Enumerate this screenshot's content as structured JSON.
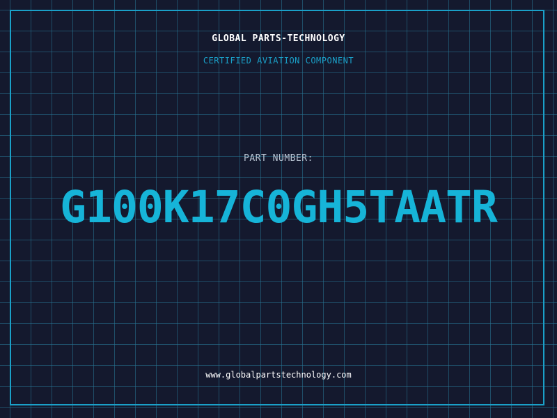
{
  "header": {
    "company_name": "GLOBAL PARTS-TECHNOLOGY",
    "subtitle": "CERTIFIED AVIATION COMPONENT"
  },
  "part": {
    "label": "PART NUMBER:",
    "number": "G100K17C0GH5TAATR"
  },
  "footer": {
    "website": "www.globalpartstechnology.com"
  },
  "colors": {
    "background": "#14192e",
    "grid": "#28788f",
    "accent": "#1aa0c8",
    "part_number": "#16b4d8",
    "text": "#ffffff"
  }
}
